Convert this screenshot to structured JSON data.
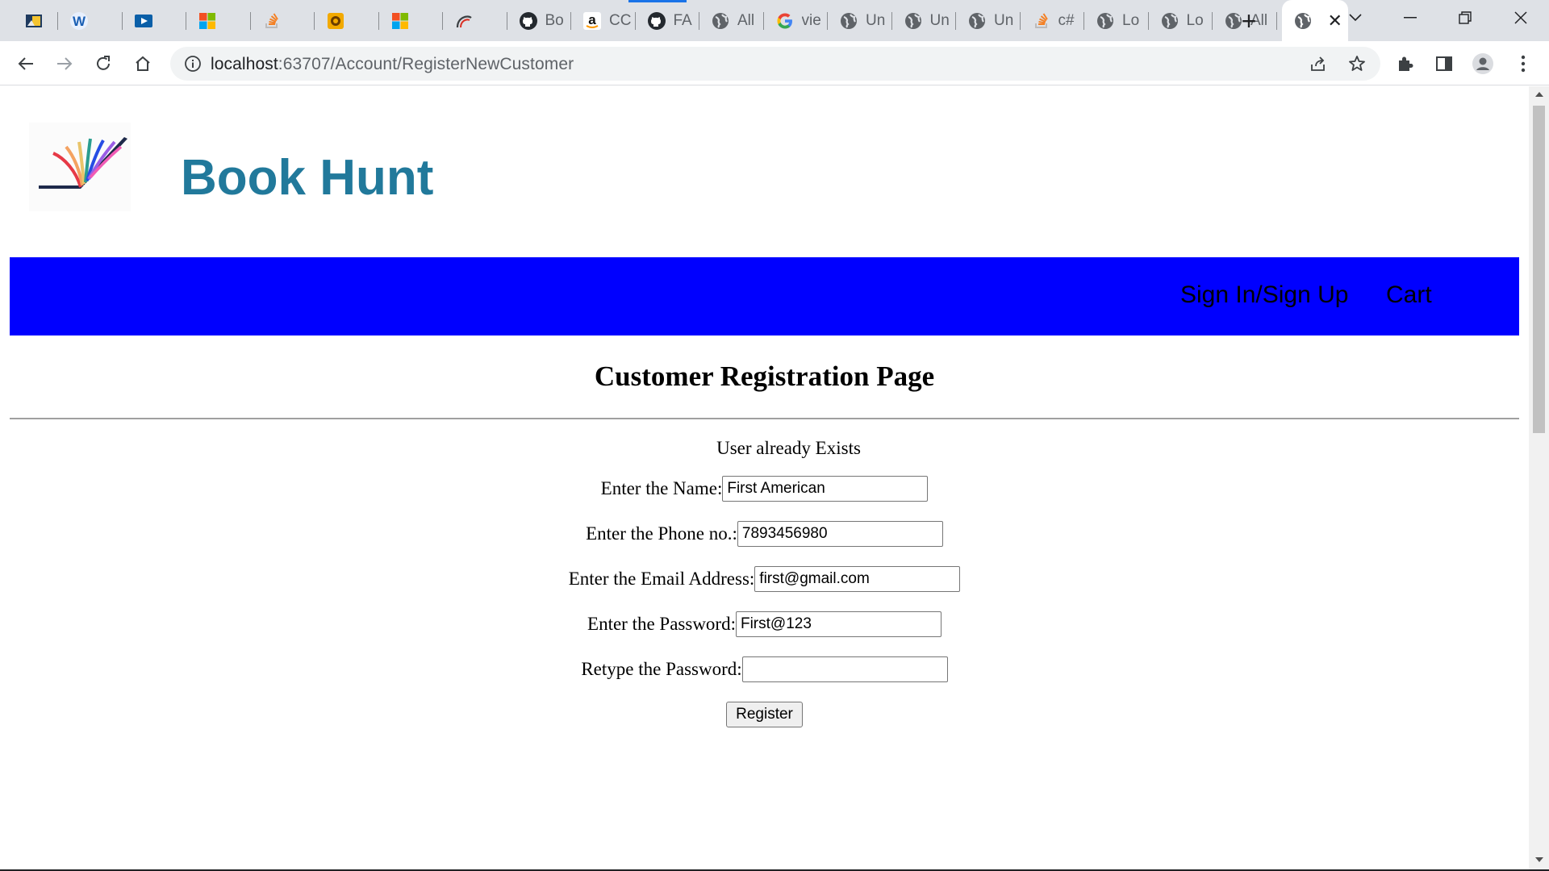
{
  "browser": {
    "tabs": [
      {
        "title": "",
        "icon": "gallery-icon"
      },
      {
        "title": "",
        "icon": "w-app-icon"
      },
      {
        "title": "",
        "icon": "video-play-icon"
      },
      {
        "title": "",
        "icon": "microsoft-icon"
      },
      {
        "title": "",
        "icon": "stackoverflow-icon"
      },
      {
        "title": "",
        "icon": "emblem-icon"
      },
      {
        "title": "",
        "icon": "microsoft-icon"
      },
      {
        "title": "",
        "icon": "arc-icon"
      },
      {
        "title": "Bo",
        "icon": "github-icon"
      },
      {
        "title": "CC",
        "icon": "amazon-icon"
      },
      {
        "title": "FA",
        "icon": "github-icon"
      },
      {
        "title": "All",
        "icon": "globe-icon"
      },
      {
        "title": "vie",
        "icon": "google-icon"
      },
      {
        "title": "Un",
        "icon": "globe-icon"
      },
      {
        "title": "Un",
        "icon": "globe-icon"
      },
      {
        "title": "Un",
        "icon": "globe-icon"
      },
      {
        "title": "c#",
        "icon": "stackoverflow-icon"
      },
      {
        "title": "Lo",
        "icon": "globe-icon"
      },
      {
        "title": "Lo",
        "icon": "globe-icon"
      },
      {
        "title": "All",
        "icon": "globe-icon"
      }
    ],
    "active_tab": {
      "title": "",
      "icon": "globe-icon"
    },
    "url_host": "localhost",
    "url_rest": ":63707/Account/RegisterNewCustomer"
  },
  "site": {
    "brand": "Book Hunt",
    "nav": {
      "signin": "Sign In/Sign Up",
      "cart": "Cart"
    }
  },
  "page": {
    "heading": "Customer Registration Page",
    "message": "User already Exists",
    "fields": {
      "name": {
        "label": "Enter the Name:",
        "value": "First American"
      },
      "phone": {
        "label": "Enter the Phone no.:",
        "value": "7893456980"
      },
      "email": {
        "label": "Enter the Email Address:",
        "value": "first@gmail.com"
      },
      "password": {
        "label": "Enter the Password:",
        "value": "First@123"
      },
      "retype": {
        "label": "Retype the Password:",
        "value": ""
      }
    },
    "register_label": "Register"
  },
  "colors": {
    "navbar": "#0000ff",
    "brand": "#21799b"
  }
}
